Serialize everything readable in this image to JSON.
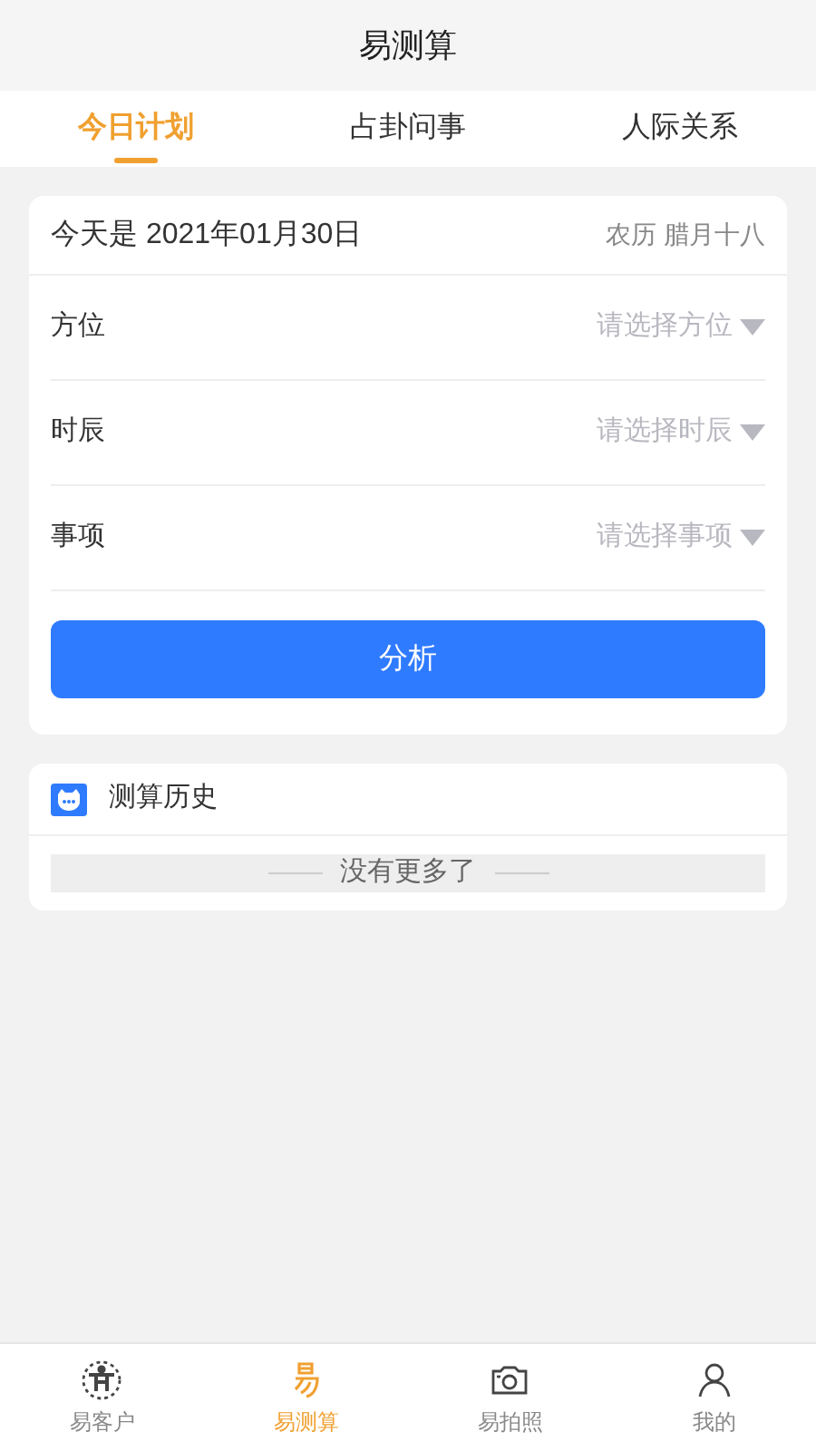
{
  "window": {
    "title": "易测算"
  },
  "tabs": [
    {
      "label": "今日计划",
      "selected": true
    },
    {
      "label": "占卦问事",
      "selected": false
    },
    {
      "label": "人际关系",
      "selected": false
    }
  ],
  "date_card": {
    "date": "今天是 2021年01月30日",
    "lunar": "农历 腊月十八"
  },
  "fields": [
    {
      "label": "方位",
      "placeholder": "请选择方位"
    },
    {
      "label": "时辰",
      "placeholder": "请选择时辰"
    },
    {
      "label": "事项",
      "placeholder": "请选择事项"
    }
  ],
  "analyze_button": "分析",
  "history": {
    "title": "测算历史",
    "empty": "没有更多了"
  },
  "bottom_nav": [
    {
      "kind": "person",
      "label": "易客户",
      "selected": false
    },
    {
      "kind": "yi",
      "label": "易测算",
      "selected": true
    },
    {
      "kind": "camera",
      "label": "易拍照",
      "selected": false
    },
    {
      "kind": "user",
      "label": "我的",
      "selected": false
    }
  ]
}
